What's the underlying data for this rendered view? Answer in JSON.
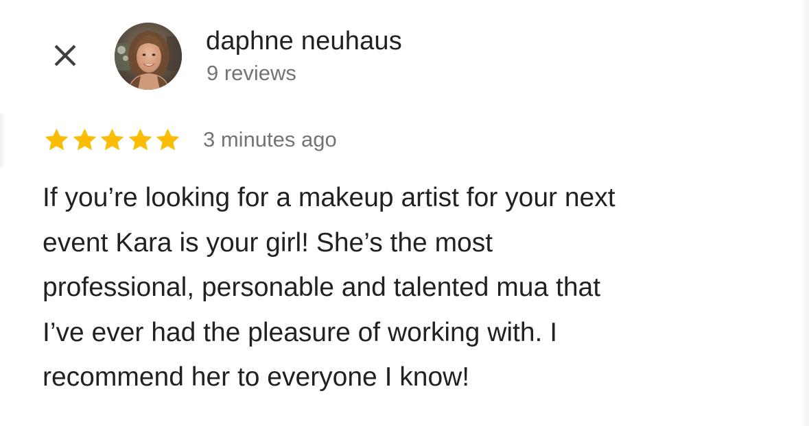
{
  "review": {
    "author_name": "daphne neuhaus",
    "author_reviews": "9 reviews",
    "rating": 5,
    "rating_max": 5,
    "time_ago": "3 minutes ago",
    "text_lines": [
      "If you’re looking for a makeup artist for your next",
      "event Kara is your girl! She’s the most",
      "professional, personable and talented mua that",
      "I’ve ever had the pleasure of working with. I",
      "recommend her to everyone I know!"
    ]
  },
  "icons": {
    "close": "close-icon",
    "star": "star-icon"
  },
  "colors": {
    "star": "#fbbc04",
    "name": "#202124",
    "secondary": "#70757a",
    "close": "#3c4043"
  }
}
